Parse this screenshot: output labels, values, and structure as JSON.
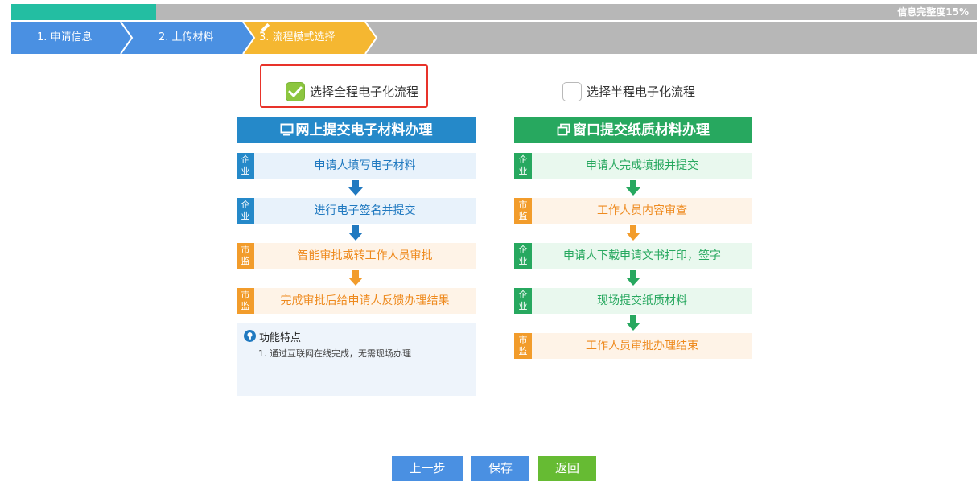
{
  "progress": {
    "percent": 15,
    "label": "信息完整度15%"
  },
  "steps": [
    {
      "label": "1. 申请信息",
      "state": "done"
    },
    {
      "label": "2. 上传材料",
      "state": "done"
    },
    {
      "label": "3. 流程模式选择",
      "state": "current"
    }
  ],
  "modes": [
    {
      "label": "选择全程电子化流程",
      "checked": true
    },
    {
      "label": "选择半程电子化流程",
      "checked": false
    }
  ],
  "online_panel": {
    "title": "网上提交电子材料办理",
    "rows": [
      {
        "tag": [
          "企",
          "业"
        ],
        "text": "申请人填写电子材料"
      },
      {
        "tag": [
          "企",
          "业"
        ],
        "text": "进行电子签名并提交"
      },
      {
        "tag": [
          "市",
          "监"
        ],
        "text": "智能审批或转工作人员审批"
      },
      {
        "tag": [
          "市",
          "监"
        ],
        "text": "完成审批后给申请人反馈办理结果"
      }
    ],
    "features_title": "功能特点",
    "features": [
      "1. 通过互联网在线完成，无需现场办理"
    ]
  },
  "window_panel": {
    "title": "窗口提交纸质材料办理",
    "rows": [
      {
        "tag": [
          "企",
          "业"
        ],
        "text": "申请人完成填报并提交"
      },
      {
        "tag": [
          "市",
          "监"
        ],
        "text": "工作人员内容审查"
      },
      {
        "tag": [
          "企",
          "业"
        ],
        "text": "申请人下载申请文书打印，签字"
      },
      {
        "tag": [
          "企",
          "业"
        ],
        "text": "现场提交纸质材料"
      },
      {
        "tag": [
          "市",
          "监"
        ],
        "text": "工作人员审批办理结束"
      }
    ]
  },
  "buttons": {
    "prev": "上一步",
    "save": "保存",
    "back": "返回"
  },
  "colors": {
    "progress_fill": "#23bea2",
    "step_done": "#4a90e2",
    "step_current": "#f5b731",
    "online_header": "#2589c9",
    "window_header": "#27a85f",
    "tag_company_online": "#2589c9",
    "tag_company_window": "#27a85f",
    "tag_supervision": "#f29c2b",
    "btn_prev": "#4a90e2",
    "btn_save": "#4a90e2",
    "btn_back": "#66bb33"
  },
  "icons": {
    "online_header": "monitor-icon",
    "window_header": "window-icon",
    "features": "lightbulb-icon",
    "current_step": "pencil-icon",
    "checked": "check-icon"
  }
}
